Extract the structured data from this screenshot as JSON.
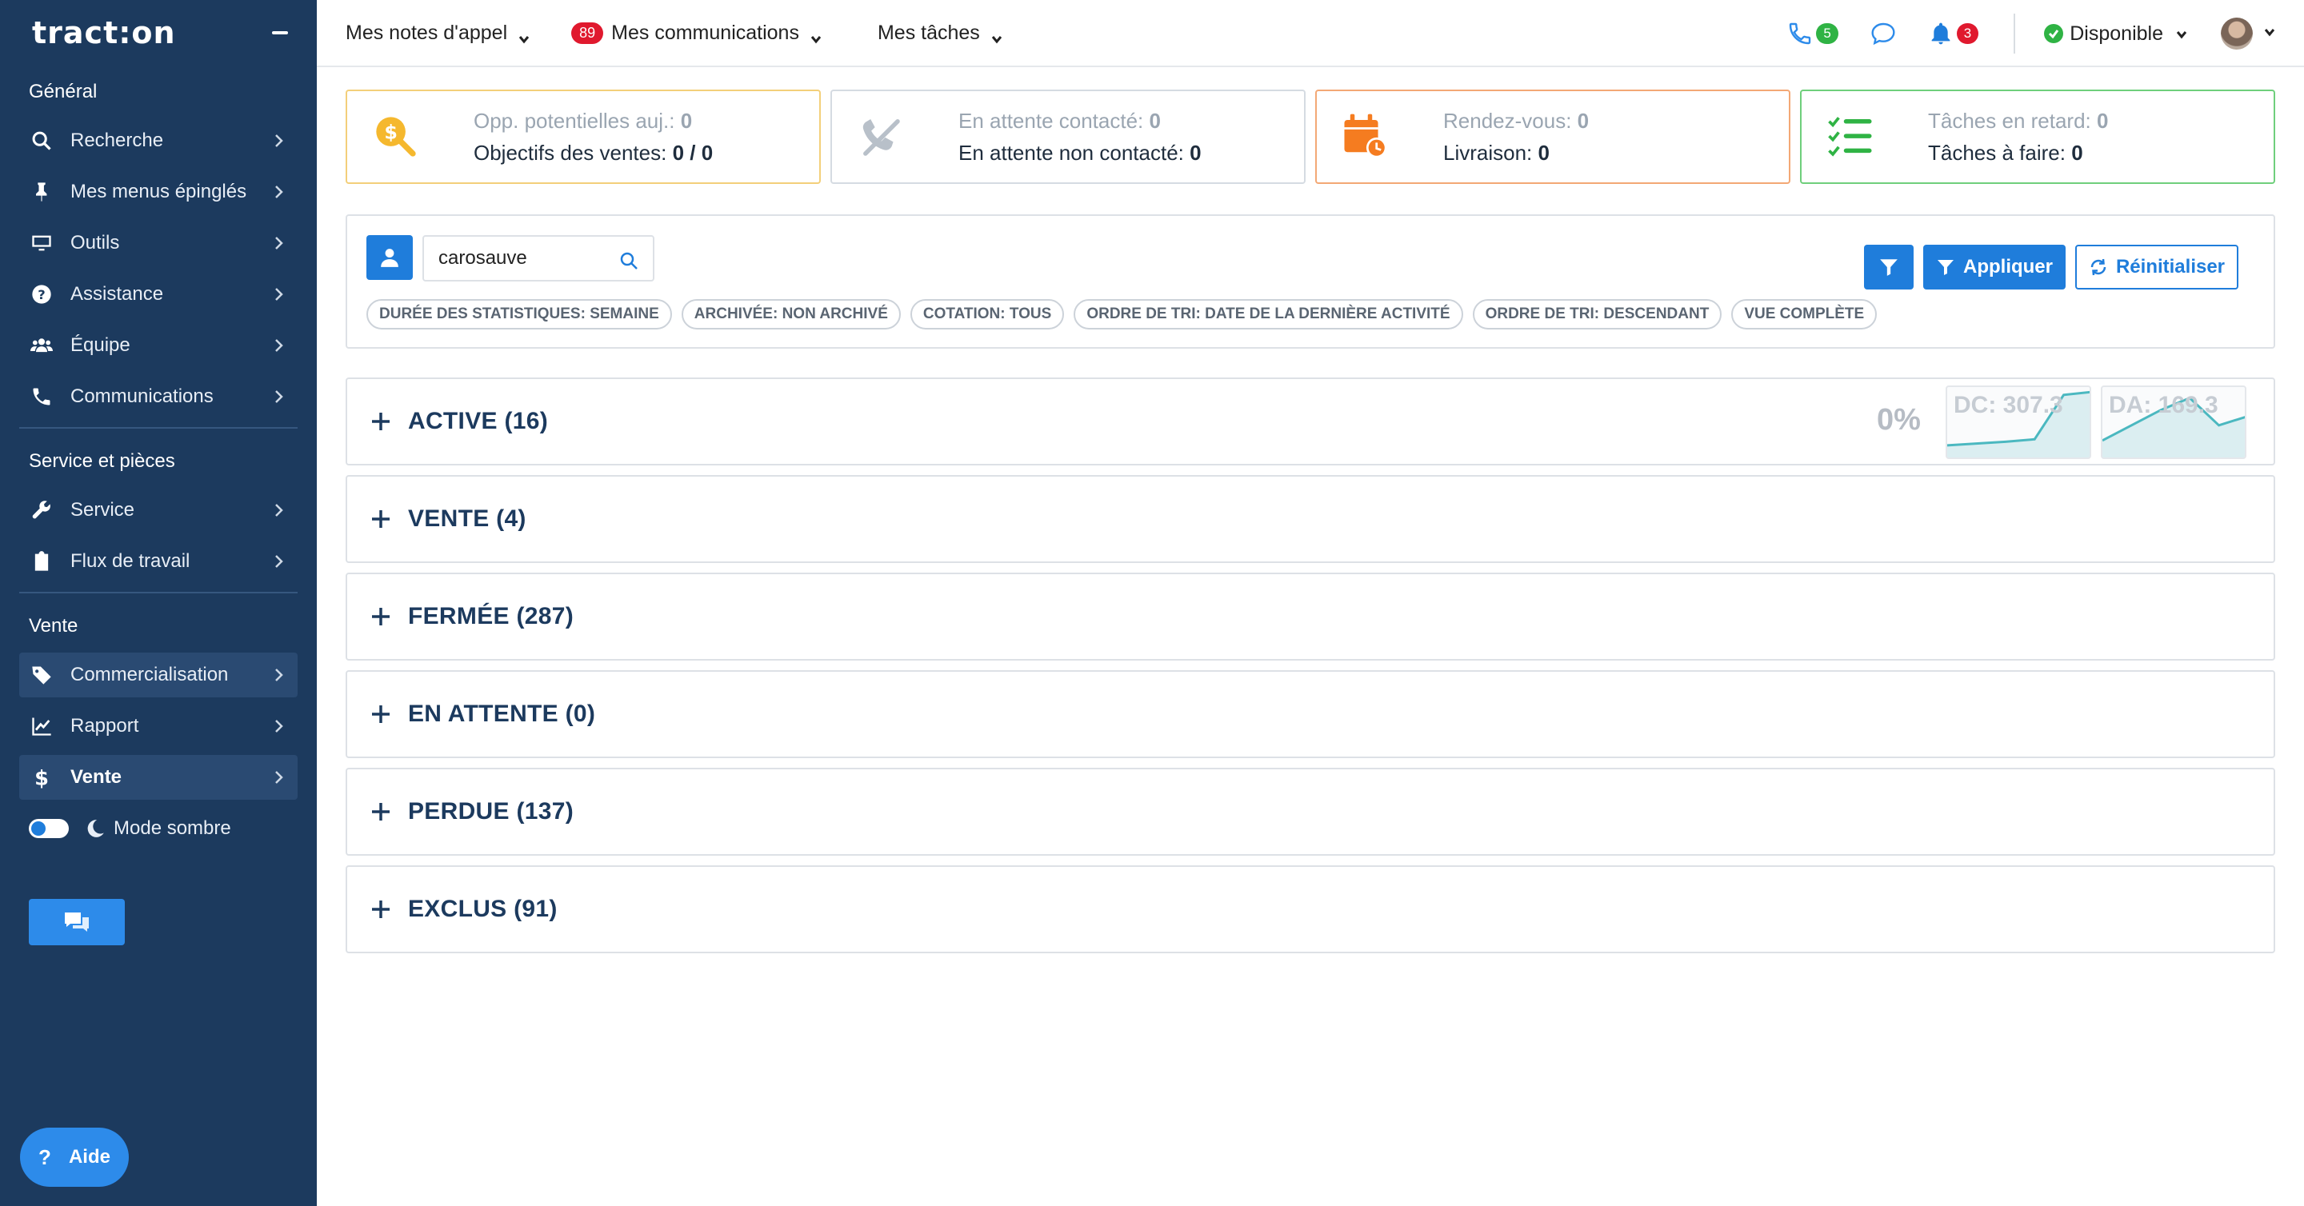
{
  "brand": {
    "logo_text": "tract:on"
  },
  "sidebar": {
    "sections": [
      {
        "title": "Général"
      },
      {
        "title": "Service et pièces"
      },
      {
        "title": "Vente"
      }
    ],
    "items": [
      {
        "label": "Recherche",
        "icon": "search-icon"
      },
      {
        "label": "Mes menus épinglés",
        "icon": "pin-icon"
      },
      {
        "label": "Outils",
        "icon": "monitor-icon"
      },
      {
        "label": "Assistance",
        "icon": "question-icon"
      },
      {
        "label": "Équipe",
        "icon": "users-icon"
      },
      {
        "label": "Communications",
        "icon": "phone-icon"
      },
      {
        "label": "Service",
        "icon": "wrench-icon"
      },
      {
        "label": "Flux de travail",
        "icon": "clipboard-icon"
      },
      {
        "label": "Commercialisation",
        "icon": "tag-icon"
      },
      {
        "label": "Rapport",
        "icon": "chart-line-icon"
      },
      {
        "label": "Vente",
        "icon": "dollar-icon"
      }
    ],
    "dark_mode_label": "Mode sombre",
    "help_label": "Aide"
  },
  "topbar": {
    "menu1": "Mes notes d'appel",
    "menu2_badge": "89",
    "menu2": "Mes communications",
    "menu3": "Mes tâches",
    "calls_count": "5",
    "notifications_count": "3",
    "status": "Disponible"
  },
  "kpis": [
    {
      "line1_label": "Opp. potentielles auj.:",
      "line1_value": "0",
      "line2_label": "Objectifs des ventes:",
      "line2_value": "0 / 0"
    },
    {
      "line1_label": "En attente contacté:",
      "line1_value": "0",
      "line2_label": "En attente non contacté:",
      "line2_value": "0"
    },
    {
      "line1_label": "Rendez-vous:",
      "line1_value": "0",
      "line2_label": "Livraison:",
      "line2_value": "0"
    },
    {
      "line1_label": "Tâches en retard:",
      "line1_value": "0",
      "line2_label": "Tâches à faire:",
      "line2_value": "0"
    }
  ],
  "filters": {
    "search_value": "carosauve",
    "tags": [
      "DURÉE DES STATISTIQUES: SEMAINE",
      "ARCHIVÉE: NON ARCHIVÉ",
      "COTATION: TOUS",
      "ORDRE DE TRI: DATE DE LA DERNIÈRE ACTIVITÉ",
      "ORDRE DE TRI: DESCENDANT",
      "VUE COMPLÈTE"
    ],
    "apply_label": "Appliquer",
    "reset_label": "Réinitialiser"
  },
  "stages": [
    {
      "label": "ACTIVE (16)"
    },
    {
      "label": "VENTE (4)"
    },
    {
      "label": "FERMÉE (287)"
    },
    {
      "label": "EN ATTENTE (0)"
    },
    {
      "label": "PERDUE (137)"
    },
    {
      "label": "EXCLUS (91)"
    }
  ],
  "active_stats": {
    "percent": "0%",
    "dc_label": "DC: 307.3",
    "da_label": "DA: 169.3",
    "dc_trend": [
      0.12,
      0.15,
      0.18,
      0.22,
      0.95,
      1.0
    ],
    "da_trend": [
      0.2,
      0.45,
      0.7,
      0.9,
      0.45,
      0.6
    ],
    "spark_color": "#4bb8c0"
  },
  "colors": {
    "sidebar_bg": "#1c3a5e",
    "accent": "#1f7ddb",
    "success": "#2fb344",
    "danger": "#e0192e"
  }
}
